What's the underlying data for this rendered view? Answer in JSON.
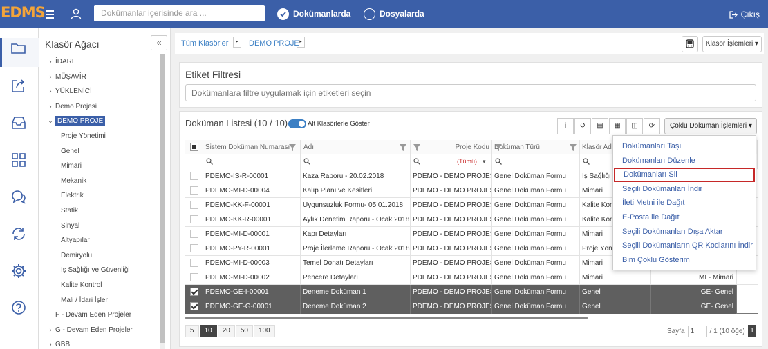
{
  "header": {
    "logo": "EDMS",
    "search_placeholder": "Dokümanlar içerisinde ara ...",
    "search_mode_documents": "Dokümanlarda",
    "search_mode_folders": "Dosyalarda",
    "search_mode_selected": "Dokümanlarda",
    "exit_label": "Çıkış"
  },
  "rail": {
    "icons": [
      "folder-icon",
      "share-icon",
      "inbox-icon",
      "grid-icon",
      "chat-icon",
      "sync-icon",
      "gear-icon",
      "help-icon"
    ],
    "active": "folder-icon"
  },
  "tree": {
    "title": "Klasör Ağacı",
    "collapse_label": "«",
    "nodes": [
      {
        "label": "İDARE",
        "caret": "›"
      },
      {
        "label": "MÜŞAVİR",
        "caret": "›"
      },
      {
        "label": "YÜKLENİCİ",
        "caret": "›"
      },
      {
        "label": "Demo Projesi",
        "caret": "›"
      },
      {
        "label": "DEMO PROJE",
        "caret": "⌄"
      },
      {
        "label": "Proje Yönetimi",
        "caret": ""
      },
      {
        "label": "Genel",
        "caret": ""
      },
      {
        "label": "Mimari",
        "caret": ""
      },
      {
        "label": "Mekanik",
        "caret": ""
      },
      {
        "label": "Elektrik",
        "caret": ""
      },
      {
        "label": "Statik",
        "caret": ""
      },
      {
        "label": "Sinyal",
        "caret": ""
      },
      {
        "label": "Altyapılar",
        "caret": ""
      },
      {
        "label": "Demiryolu",
        "caret": ""
      },
      {
        "label": "İş Sağlığı ve Güvenliği",
        "caret": ""
      },
      {
        "label": "Kalite Kontrol",
        "caret": ""
      },
      {
        "label": "Mali / İdari İşler",
        "caret": ""
      },
      {
        "label": "F - Devam Eden Projeler",
        "caret": ""
      },
      {
        "label": "G - Devam Eden Projeler",
        "caret": "›"
      },
      {
        "label": "GBB",
        "caret": "›"
      }
    ],
    "selected": "DEMO PROJE"
  },
  "breadcrumb": {
    "items": [
      "Tüm Klasörler",
      "DEMO PROJE"
    ],
    "sep": "▸"
  },
  "toolbar": {
    "folder_ops_label": "Klasör İşlemleri ▾"
  },
  "tag_filter": {
    "title": "Etiket Filtresi",
    "placeholder": "Dokümanlara filtre uygulamak için etiketleri seçin"
  },
  "doc_list": {
    "title": "Doküman Listesi (10 / 10)",
    "subfolders_toggle_label": "Alt Klasörlerle Göster",
    "subfolders_toggle_on": true,
    "tool_buttons": [
      "i",
      "↺",
      "▤",
      "▦",
      "◫",
      "⟳"
    ],
    "multi_ops_label": "Çoklu Doküman İşlemleri ▾",
    "columns": [
      "Sistem Doküman Numarası",
      "Adı",
      "Proje Kodu",
      "Doküman Türü",
      "Klasör Adı"
    ],
    "filter_all": "(Tümü)",
    "rows": [
      {
        "no": "PDEMO-İS-R-00001",
        "name": "Kaza Raporu - 20.02.2018",
        "project": "PDEMO - DEMO PROJESİ",
        "type": "Genel Doküman Formu",
        "folder": "İş Sağlığı ve",
        "extra": "",
        "checked": false,
        "dark": false
      },
      {
        "no": "PDEMO-MI-D-00004",
        "name": "Kalıp Planı ve Kesitleri",
        "project": "PDEMO - DEMO PROJESİ",
        "type": "Genel Doküman Formu",
        "folder": "Mimari",
        "extra": "",
        "checked": false,
        "dark": false
      },
      {
        "no": "PDEMO-KK-F-00001",
        "name": "Uygunsuzluk Formu- 05.01.2018",
        "project": "PDEMO - DEMO PROJESİ",
        "type": "Genel Doküman Formu",
        "folder": "Kalite Kont",
        "extra": "",
        "checked": false,
        "dark": false
      },
      {
        "no": "PDEMO-KK-R-00001",
        "name": "Aylık Denetim Raporu - Ocak 2018",
        "project": "PDEMO - DEMO PROJESİ",
        "type": "Genel Doküman Formu",
        "folder": "Kalite Kont",
        "extra": "",
        "checked": false,
        "dark": false
      },
      {
        "no": "PDEMO-MI-D-00001",
        "name": "Kapı Detayları",
        "project": "PDEMO - DEMO PROJESİ",
        "type": "Genel Doküman Formu",
        "folder": "Mimari",
        "extra": "",
        "checked": false,
        "dark": false
      },
      {
        "no": "PDEMO-PY-R-00001",
        "name": "Proje İlerleme Raporu - Ocak 2018",
        "project": "PDEMO - DEMO PROJESİ",
        "type": "Genel Doküman Formu",
        "folder": "Proje Yöne",
        "extra": "",
        "checked": false,
        "dark": false
      },
      {
        "no": "PDEMO-MI-D-00003",
        "name": "Temel Donatı Detayları",
        "project": "PDEMO - DEMO PROJESİ",
        "type": "Genel Doküman Formu",
        "folder": "Mimari",
        "extra": "",
        "checked": false,
        "dark": false
      },
      {
        "no": "PDEMO-MI-D-00002",
        "name": "Pencere Detayları",
        "project": "PDEMO - DEMO PROJESİ",
        "type": "Genel Doküman Formu",
        "folder": "Mimari",
        "extra": "MI - Mimari",
        "checked": false,
        "dark": false
      },
      {
        "no": "PDEMO-GE-I-00001",
        "name": "Deneme Doküman 1",
        "project": "PDEMO - DEMO PROJESİ",
        "type": "Genel Doküman Formu",
        "folder": "Genel",
        "extra": "GE- Genel",
        "checked": true,
        "dark": true
      },
      {
        "no": "PDEMO-GE-G-00001",
        "name": "Deneme Doküman 2",
        "project": "PDEMO - DEMO PROJESİ",
        "type": "Genel Doküman Formu",
        "folder": "Genel",
        "extra": "GE- Genel",
        "checked": true,
        "dark": true
      }
    ]
  },
  "pager": {
    "sizes": [
      "5",
      "10",
      "20",
      "50",
      "100"
    ],
    "selected_size": "10",
    "page_label": "Sayfa",
    "page_value": "1",
    "page_total": "/ 1 (10 öğe)",
    "last_page_btn": "1"
  },
  "multi_ops_menu": {
    "items": [
      "Dokümanları Taşı",
      "Dokümanları Düzenle",
      "Dokümanları Sil",
      "Seçili Dokümanları İndir",
      "İleti Metni ile Dağıt",
      "E-Posta ile Dağıt",
      "Seçili Dokümanları Dışa Aktar",
      "Seçili Dokümanların QR Kodlarını İndir",
      "Bim Çoklu Gösterim"
    ],
    "highlighted": "Dokümanları Sil"
  },
  "colors": {
    "header_bg": "#3b5fa8",
    "logo": "#f2a43a",
    "link": "#3b7fc4",
    "selected_row_bg": "#5f5f5f",
    "highlight_border": "#c62828"
  }
}
